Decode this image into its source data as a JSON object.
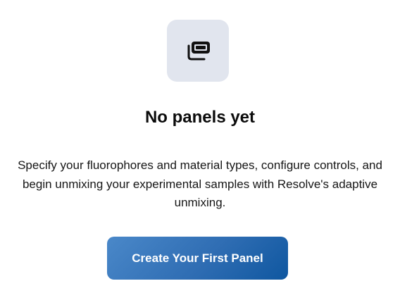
{
  "empty_state": {
    "icon": "stacked-panels-icon",
    "title": "No panels yet",
    "description": "Specify your fluorophores and material types, configure controls, and begin unmixing your experimental samples with Resolve's adaptive unmixing.",
    "cta_label": "Create Your First Panel"
  },
  "colors": {
    "icon_tile_bg": "#e1e5ee",
    "icon": "#111111",
    "button_gradient_start": "#4a88c9",
    "button_gradient_end": "#0f57a0",
    "button_text": "#ffffff"
  }
}
